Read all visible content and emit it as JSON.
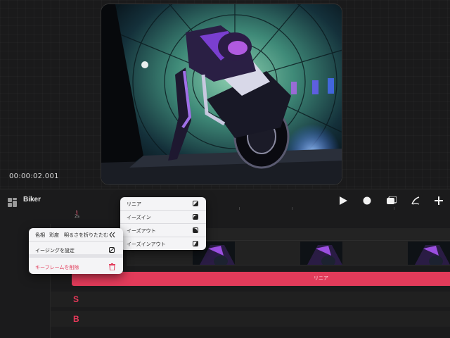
{
  "preview": {
    "timecode": "00:00:02.001"
  },
  "toolbar": {
    "project_title": "Biker",
    "icons": [
      "layers-icon",
      "play-icon",
      "record-icon",
      "clips-icon",
      "brush-icon",
      "add-icon"
    ]
  },
  "ruler": {
    "label": "2s"
  },
  "tracks": {
    "h_label": "H",
    "s_label": "S",
    "b_label": "B",
    "h_curve_label": "リニア"
  },
  "easing_menu": {
    "items": [
      {
        "label": "リニア",
        "icon": "linear-icon"
      },
      {
        "label": "イーズイン",
        "icon": "ease-in-icon"
      },
      {
        "label": "イーズアウト",
        "icon": "ease-out-icon"
      },
      {
        "label": "イーズインアウト",
        "icon": "ease-in-out-icon"
      }
    ]
  },
  "action_menu": {
    "hue": "色相",
    "saturation": "彩度",
    "brightness": "明るさを折りたたむ",
    "set_easing": "イージングを設定",
    "delete_keyframe": "キーフレームを削除"
  },
  "colors": {
    "accent": "#e23b5a",
    "background": "#1b1b1c",
    "menu_bg": "#f4f4f6"
  }
}
